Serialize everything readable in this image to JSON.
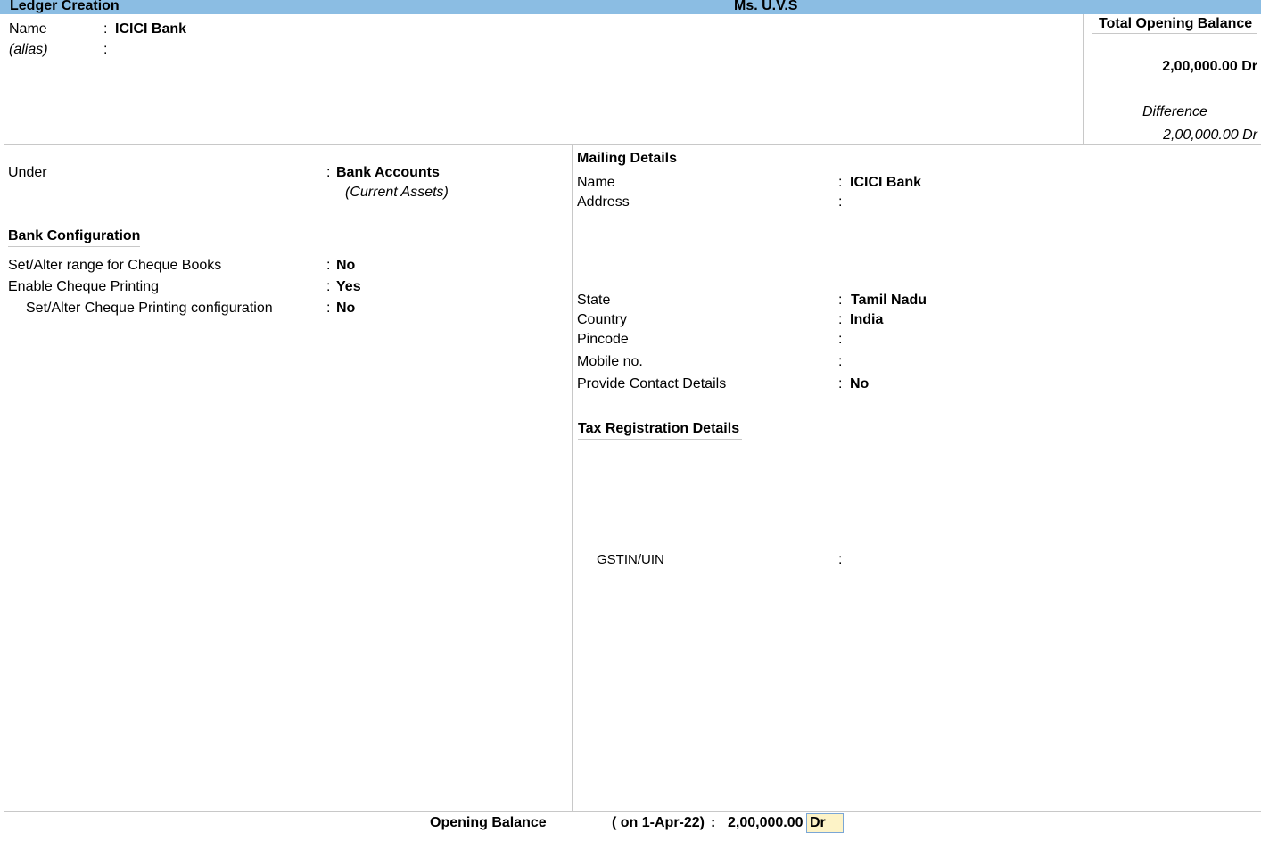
{
  "header": {
    "screen_title": "Ledger Creation",
    "company_name": "Ms. U.V.S"
  },
  "ledger": {
    "name_label": "Name",
    "name_value": "ICICI Bank",
    "alias_label": "(alias)",
    "alias_value": ""
  },
  "balance_panel": {
    "total_label": "Total Opening Balance",
    "total_value": "2,00,000.00 Dr",
    "difference_label": "Difference",
    "difference_value": "2,00,000.00 Dr"
  },
  "under": {
    "label": "Under",
    "value": "Bank Accounts",
    "parent": "(Current Assets)"
  },
  "bank_configuration": {
    "heading": "Bank Configuration",
    "rows": [
      {
        "label": "Set/Alter range for Cheque Books",
        "value": "No"
      },
      {
        "label": "Enable Cheque Printing",
        "value": "Yes"
      },
      {
        "label": "Set/Alter Cheque Printing configuration",
        "value": "No"
      }
    ]
  },
  "mailing": {
    "heading": "Mailing Details",
    "name_label": "Name",
    "name_value": "ICICI Bank",
    "address_label": "Address",
    "address_value": "",
    "state_label": "State",
    "state_value": "Tamil Nadu",
    "country_label": "Country",
    "country_value": "India",
    "pincode_label": "Pincode",
    "pincode_value": "",
    "mobile_label": "Mobile no.",
    "mobile_value": "",
    "contact_label": "Provide Contact Details",
    "contact_value": "No"
  },
  "tax": {
    "heading": "Tax Registration Details",
    "gstin_label": "GSTIN/UIN",
    "gstin_value": ""
  },
  "opening_balance": {
    "label": "Opening Balance",
    "date_text": "( on 1-Apr-22)",
    "separator": ":",
    "amount": "2,00,000.00",
    "dr_cr": "Dr"
  },
  "colors": {
    "title_bar": "#8bbde3",
    "dr_cr_field": "#fdf3c7"
  }
}
